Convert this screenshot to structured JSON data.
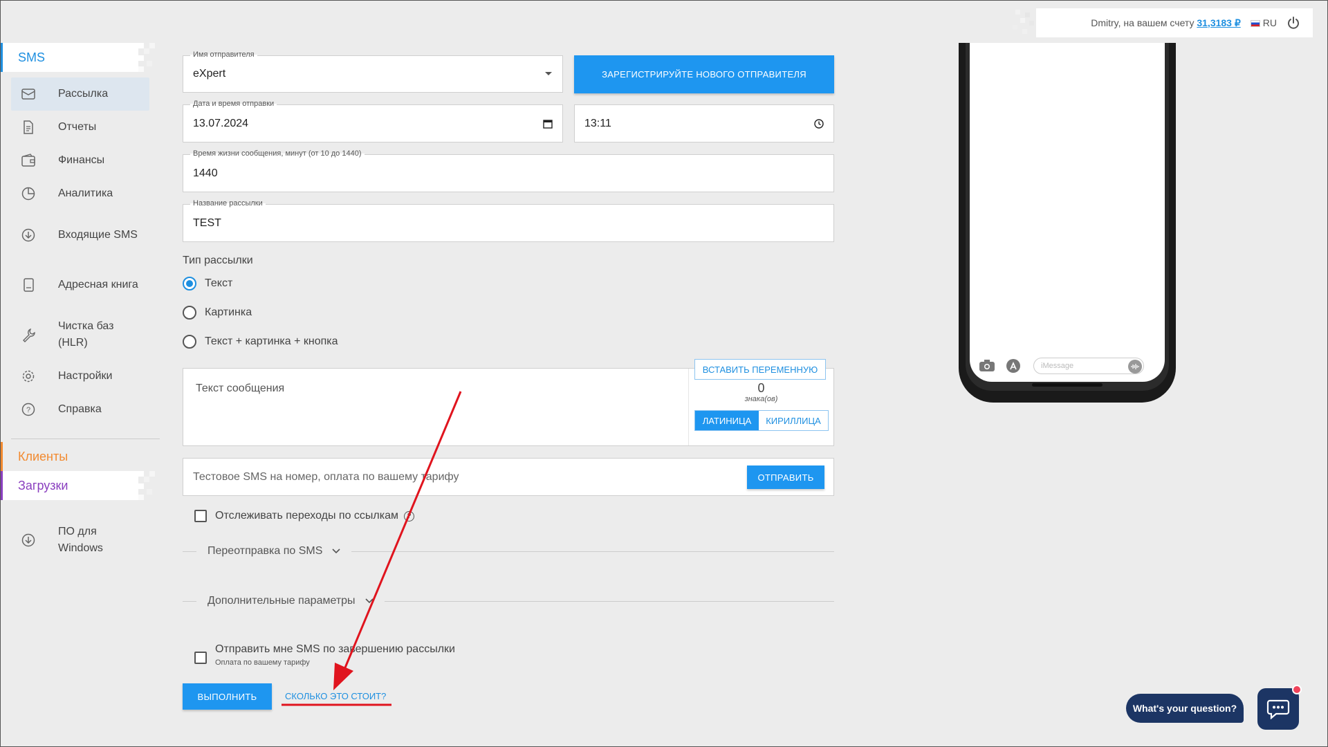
{
  "topbar": {
    "user_text": "Dmitry, на вашем счету",
    "balance": "31,3183 ₽",
    "lang": "RU"
  },
  "sidebar": {
    "sms_title": "SMS",
    "items": [
      {
        "label": "Рассылка",
        "icon": "envelope-icon"
      },
      {
        "label": "Отчеты",
        "icon": "document-icon"
      },
      {
        "label": "Финансы",
        "icon": "wallet-icon"
      },
      {
        "label": "Аналитика",
        "icon": "pie-chart-icon"
      },
      {
        "label": "Входящие SMS",
        "icon": "download-circle-icon"
      },
      {
        "label": "Адресная книга",
        "icon": "book-icon"
      },
      {
        "label": "Чистка баз (HLR)",
        "icon": "wrench-icon"
      },
      {
        "label": "Настройки",
        "icon": "gear-icon"
      },
      {
        "label": "Справка",
        "icon": "help-icon"
      }
    ],
    "clients_title": "Клиенты",
    "downloads_title": "Загрузки",
    "windows_label": "ПО для Windows"
  },
  "form": {
    "sender_label": "Имя отправителя",
    "sender_value": "eXpert",
    "register_sender_button": "ЗАРЕГИСТРИРУЙТЕ НОВОГО ОТПРАВИТЕЛЯ",
    "datetime_label": "Дата и время отправки",
    "date_value": "13.07.2024",
    "time_value": "13:11",
    "lifetime_label": "Время жизни сообщения, минут (от 10 до 1440)",
    "lifetime_value": "1440",
    "campaign_name_label": "Название рассылки",
    "campaign_name_value": "TEST",
    "type_title": "Тип рассылки",
    "type_options": [
      "Текст",
      "Картинка",
      "Текст + картинка + кнопка"
    ],
    "type_selected": "Текст",
    "message_placeholder": "Текст сообщения",
    "insert_variable_button": "ВСТАВИТЬ ПЕРЕМЕННУЮ",
    "char_count": "0",
    "char_label": "знака(ов)",
    "latin_button": "ЛАТИНИЦА",
    "cyrillic_button": "КИРИЛЛИЦА",
    "test_sms_placeholder": "Тестовое SMS на номер, оплата по вашему тарифу",
    "send_button": "ОТПРАВИТЬ",
    "track_links_label": "Отслеживать переходы по ссылкам",
    "resend_section": "Переотправка по SMS",
    "extra_section": "Дополнительные параметры",
    "notify_label": "Отправить мне SMS по завершению рассылки",
    "notify_sub": "Оплата по вашему тарифу",
    "execute_button": "ВЫПОЛНИТЬ",
    "cost_link": "СКОЛЬКО ЭТО СТОИТ?"
  },
  "phone_preview": {
    "imessage_placeholder": "iMessage"
  },
  "chat": {
    "question": "What's your question?"
  },
  "colors": {
    "accent": "#1e96f0",
    "clients": "#f28a2f",
    "downloads": "#8a3fbf",
    "annotation": "#e0141e",
    "chat_bg": "#1c3564"
  }
}
